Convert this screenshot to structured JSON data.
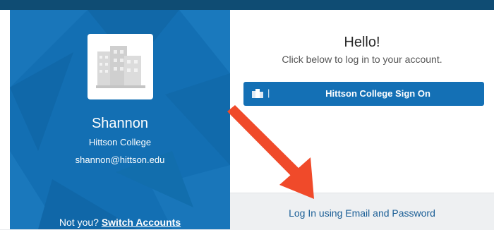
{
  "user": {
    "name": "Shannon",
    "college": "Hittson College",
    "email": "shannon@hittson.edu"
  },
  "switch": {
    "prefix": "Not you?",
    "link_label": "Switch Accounts"
  },
  "login": {
    "title": "Hello!",
    "subtitle": "Click below to log in to your account.",
    "sso_separator": "|",
    "sso_button_label": "Hittson College Sign On",
    "email_link_label": "Log In using Email and Password"
  },
  "colors": {
    "panel_blue": "#136fb3",
    "button_blue": "#1470b5",
    "top_bar": "#0f4c73",
    "arrow_red": "#f04a2a"
  },
  "icons": {
    "avatar": "building-icon",
    "sso": "building-icon",
    "annotation": "red-arrow"
  }
}
